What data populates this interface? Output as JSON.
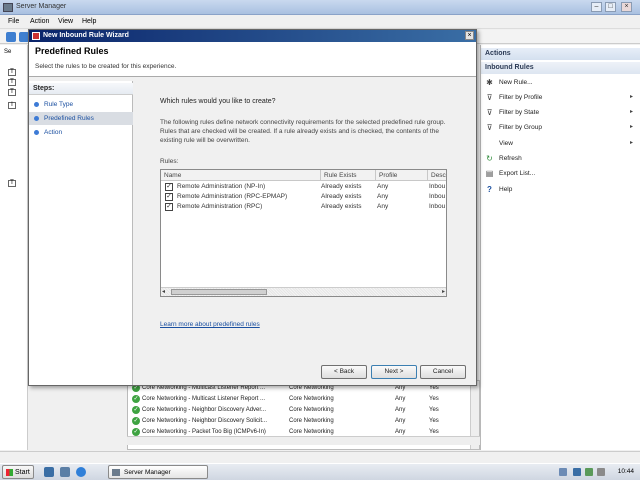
{
  "server_manager": {
    "title": "Server Manager",
    "menu": [
      "File",
      "Action",
      "View",
      "Help"
    ],
    "left_tree_stub": [
      "Se",
      "T",
      "T",
      "T",
      "I",
      "T"
    ],
    "rules_rows": [
      {
        "name": "Core Networking - Multicast Listener Report ...",
        "group": "Core Networking",
        "profile": "Any",
        "enabled": "Yes"
      },
      {
        "name": "Core Networking - Multicast Listener Report ...",
        "group": "Core Networking",
        "profile": "Any",
        "enabled": "Yes"
      },
      {
        "name": "Core Networking - Neighbor Discovery Adver...",
        "group": "Core Networking",
        "profile": "Any",
        "enabled": "Yes"
      },
      {
        "name": "Core Networking - Neighbor Discovery Solicit...",
        "group": "Core Networking",
        "profile": "Any",
        "enabled": "Yes"
      },
      {
        "name": "Core Networking - Packet Too Big (ICMPv6-In)",
        "group": "Core Networking",
        "profile": "Any",
        "enabled": "Yes"
      }
    ]
  },
  "actions_pane": {
    "header": "Actions",
    "subheader": "Inbound Rules",
    "items": [
      {
        "label": "New Rule...",
        "icon": "new-rule-icon",
        "glyph": "✱",
        "arrow": ""
      },
      {
        "label": "Filter by Profile",
        "icon": "filter-icon",
        "glyph": "⊽",
        "arrow": "▸"
      },
      {
        "label": "Filter by State",
        "icon": "filter-icon",
        "glyph": "⊽",
        "arrow": "▸"
      },
      {
        "label": "Filter by Group",
        "icon": "filter-icon",
        "glyph": "⊽",
        "arrow": "▸"
      },
      {
        "label": "View",
        "icon": "",
        "glyph": "",
        "arrow": "▸"
      },
      {
        "label": "Refresh",
        "icon": "refresh-icon",
        "glyph": "↻",
        "arrow": ""
      },
      {
        "label": "Export List...",
        "icon": "export-icon",
        "glyph": "▤",
        "arrow": ""
      },
      {
        "label": "Help",
        "icon": "help-icon",
        "glyph": "?",
        "arrow": ""
      }
    ]
  },
  "wizard": {
    "title": "New Inbound Rule Wizard",
    "heading": "Predefined Rules",
    "subheading": "Select the rules to be created for this experience.",
    "steps_header": "Steps:",
    "steps": [
      "Rule Type",
      "Predefined Rules",
      "Action"
    ],
    "current_step": 1,
    "question": "Which rules would you like to create?",
    "description": "The following rules define network connectivity requirements for the selected predefined rule group. Rules that are checked will be created. If a rule already exists and is checked, the contents of the existing rule will be overwritten.",
    "rules_label": "Rules:",
    "columns": [
      "Name",
      "Rule Exists",
      "Profile",
      "Descr"
    ],
    "rules": [
      {
        "name": "Remote Administration (NP-In)",
        "exists": "Already exists",
        "profile": "Any",
        "desc": "Inbou",
        "checked": true
      },
      {
        "name": "Remote Administration (RPC-EPMAP)",
        "exists": "Already exists",
        "profile": "Any",
        "desc": "Inbou",
        "checked": true
      },
      {
        "name": "Remote Administration (RPC)",
        "exists": "Already exists",
        "profile": "Any",
        "desc": "Inbou",
        "checked": true
      }
    ],
    "learn_more": "Learn more about predefined rules",
    "buttons": {
      "back": "< Back",
      "next": "Next >",
      "cancel": "Cancel"
    }
  },
  "taskbar": {
    "start": "Start",
    "task_button": "Server Manager",
    "clock": "10:44"
  }
}
